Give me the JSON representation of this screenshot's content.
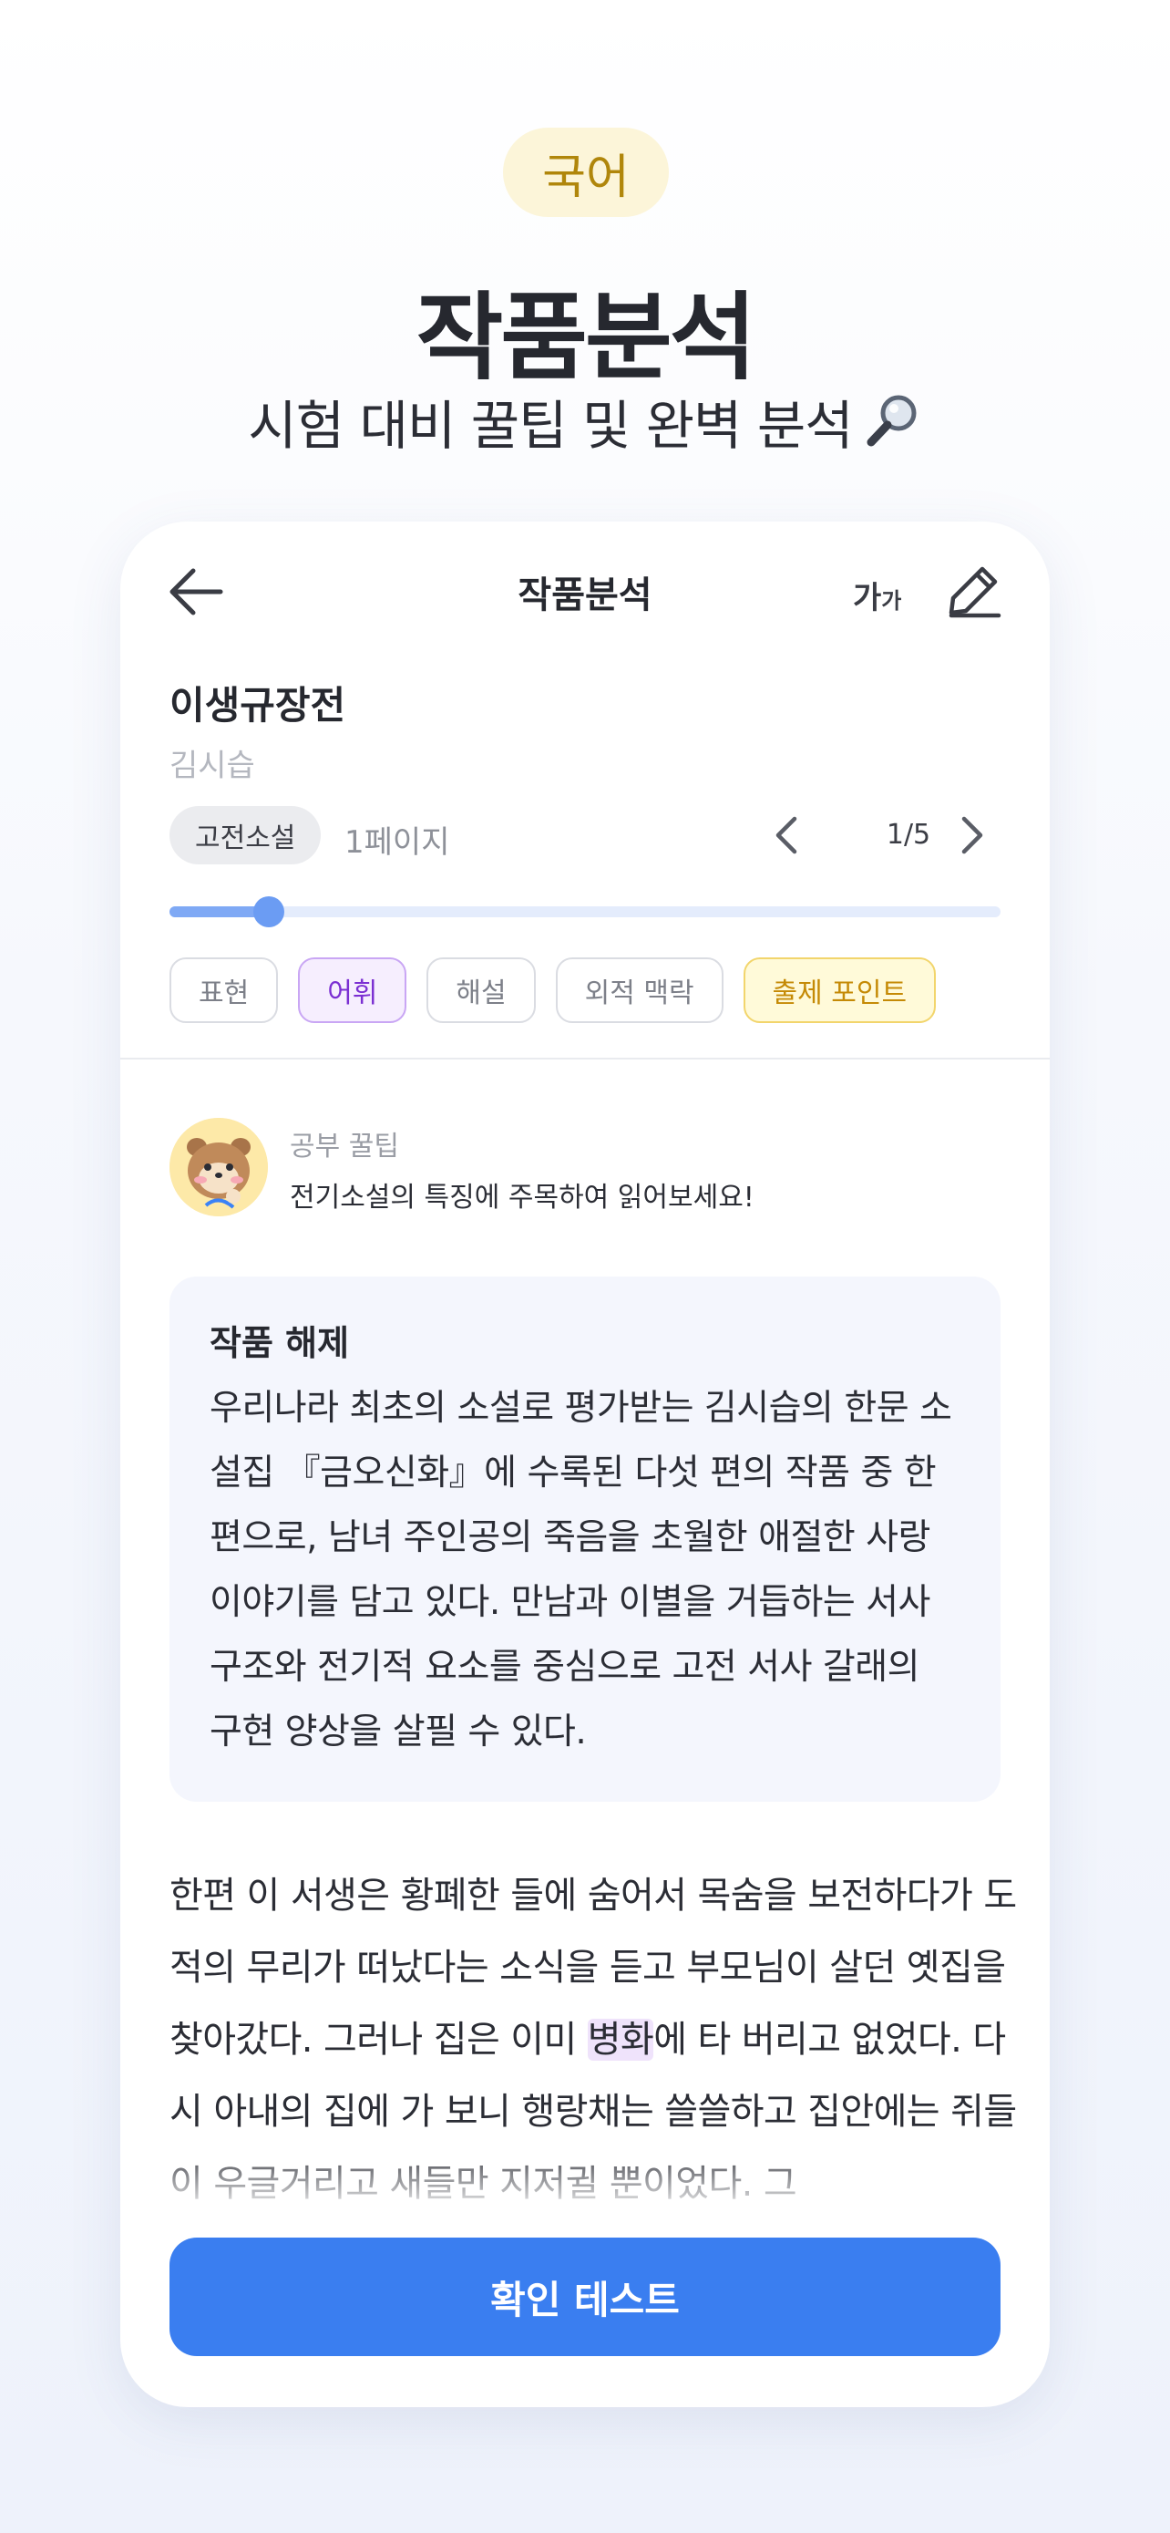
{
  "header": {
    "subject": "국어",
    "title": "작품분석",
    "subtitle": "시험 대비 꿀팁 및 완벽 분석",
    "subtitle_icon": "magnifier-icon"
  },
  "nav": {
    "title": "작품분석",
    "font_size_label_big": "가",
    "font_size_label_small": "가",
    "icons": [
      "back-arrow-icon",
      "font-size-icon",
      "pencil-icon"
    ]
  },
  "work": {
    "title": "이생규장전",
    "author": "김시습",
    "genre": "고전소설",
    "page_label": "1페이지",
    "pager": "1/5",
    "progress": 0.12
  },
  "chips": {
    "expression": "표현",
    "vocabulary": "어휘",
    "commentary": "해설",
    "context": "외적 맥락",
    "exam_point": "출제 포인트"
  },
  "tip": {
    "label": "공부 꿀팁",
    "text": "전기소설의 특징에 주목하여 읽어보세요!"
  },
  "summary": {
    "heading": "작품 해제",
    "body": "우리나라 최초의 소설로 평가받는 김시습의 한문 소설집 『금오신화』에 수록된 다섯 편의 작품 중 한 편으로, 남녀 주인공의 죽음을 초월한 애절한 사랑 이야기를 담고 있다. 만남과 이별을 거듭하는 서사 구조와 전기적 요소를 중심으로 고전 서사 갈래의 구현 양상을 살필 수 있다."
  },
  "passage": {
    "before": "한편 이 서생은 황폐한 들에 숨어서 목숨을 보전하다가 도적의 무리가 떠났다는 소식을 듣고 부모님이 살던 옛집을 찾아갔다. 그러나 집은 이미 ",
    "highlight": "병화",
    "after": "에 타 버리고 없었다. 다시 아내의 집에 가 보니 행랑채는 쓸쓸하고 집안에는 쥐들이 우글거리고 새들만 지저귈 뿐이었다. 그"
  },
  "cta": {
    "label": "확인 테스트"
  },
  "colors": {
    "accent": "#3a7ef0",
    "subject_pill_bg": "#fcf5d9",
    "subject_pill_text": "#b0860b",
    "chip_active": "#7b2fd2",
    "chip_point": "#c58a06"
  }
}
